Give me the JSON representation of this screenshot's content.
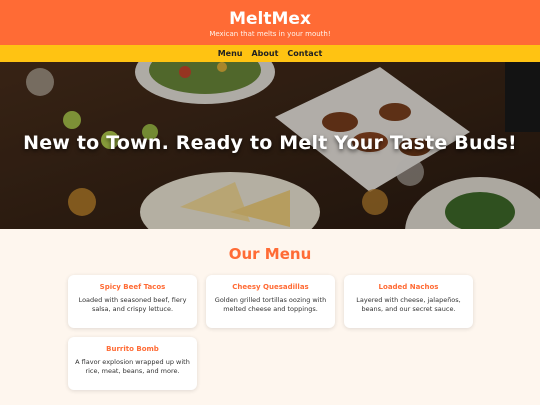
{
  "header": {
    "logo": "MeltMex",
    "tagline": "Mexican that melts in your mouth!"
  },
  "nav": {
    "items": [
      "Menu",
      "About",
      "Contact"
    ]
  },
  "hero": {
    "title": "New to Town. Ready to Melt Your Taste Buds!"
  },
  "menu": {
    "heading": "Our Menu",
    "items": [
      {
        "title": "Spicy Beef Tacos",
        "desc": "Loaded with seasoned beef, fiery salsa, and crispy lettuce."
      },
      {
        "title": "Cheesy Quesadillas",
        "desc": "Golden grilled tortillas oozing with melted cheese and toppings."
      },
      {
        "title": "Loaded Nachos",
        "desc": "Layered with cheese, jalapeños, beans, and our secret sauce."
      },
      {
        "title": "Burrito Bomb",
        "desc": "A flavor explosion wrapped up with rice, meat, beans, and more."
      }
    ]
  },
  "colors": {
    "header": "#ff6b35",
    "nav": "#ffc312",
    "page_bg": "#fef6ee",
    "accent": "#ff6b35"
  }
}
